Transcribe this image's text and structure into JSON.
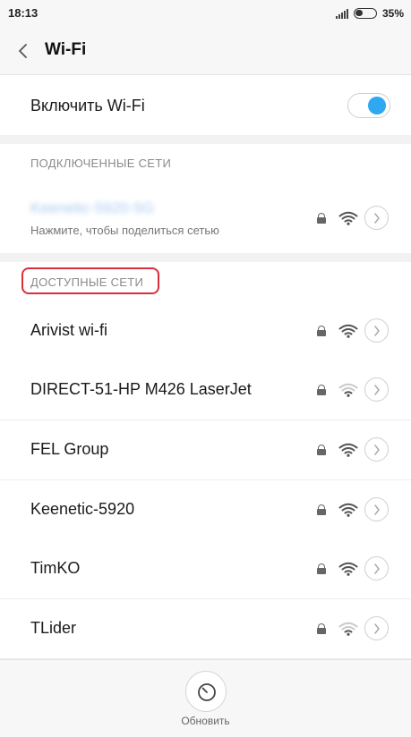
{
  "status_bar": {
    "time": "18:13",
    "battery_percent": "35%",
    "icons": [
      "signal-icon",
      "battery-icon"
    ]
  },
  "header": {
    "title": "Wi-Fi",
    "back_icon": "chevron-left-icon"
  },
  "wifi_toggle": {
    "label": "Включить Wi-Fi",
    "state": true,
    "accent_color": "#2ea8f0"
  },
  "connected": {
    "section_label": "ПОДКЛЮЧЕННЫЕ СЕТИ",
    "network": {
      "name": "Keenetic-5920-5G",
      "name_blurred": true,
      "subtitle": "Нажмите, чтобы поделиться сетью",
      "secured": true,
      "signal": 4
    }
  },
  "available": {
    "section_label": "ДОСТУПНЫЕ СЕТИ",
    "highlight_color": "#d8303b",
    "networks": [
      {
        "name": "Arivist wi-fi",
        "secured": true,
        "signal": 4
      },
      {
        "name": "DIRECT-51-HP M426 LaserJet",
        "secured": true,
        "signal": 2
      },
      {
        "name": "FEL Group",
        "secured": true,
        "signal": 4
      },
      {
        "name": "Keenetic-5920",
        "secured": true,
        "signal": 4
      },
      {
        "name": "TimKO",
        "secured": true,
        "signal": 4
      },
      {
        "name": "TLider",
        "secured": true,
        "signal": 2
      }
    ]
  },
  "footer": {
    "refresh_label": "Обновить",
    "refresh_icon": "refresh-icon"
  }
}
